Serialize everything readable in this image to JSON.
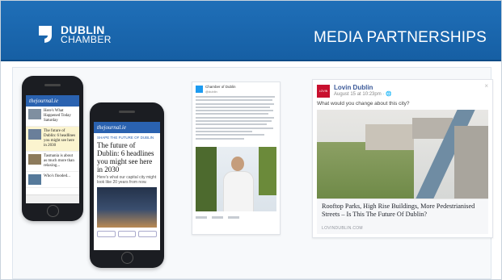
{
  "header": {
    "logo_line1": "DUBLIN",
    "logo_line2": "CHAMBER",
    "title": "MEDIA PARTNERSHIPS",
    "bg_color": "#1b66ad"
  },
  "phone_left": {
    "brand": "thejournal.ie",
    "items": [
      {
        "text": "Here's What Happened Today Saturday"
      },
      {
        "text": "The future of Dublin: 6 headlines you might see here in 2030"
      },
      {
        "text": "Tasmania is about as much more than relaxing..."
      },
      {
        "text": "Who's flooded..."
      }
    ]
  },
  "phone_right": {
    "brand": "thejournal.ie",
    "tag": "SHAPE THE FUTURE OF DUBLIN",
    "headline": "The future of Dublin: 6 headlines you might see here in 2030",
    "sub": "Here's what our capital city might look like 20 years from now."
  },
  "tweet": {
    "name": "Chamber of Dublin",
    "handle": "@dublin"
  },
  "facebook_post": {
    "page_name": "Lovin Dublin",
    "date": "August 15 at 10:23pm · 🌐",
    "status": "What would you change about this city?",
    "link_headline": "Rooftop Parks, High Rise Buildings, More Pedestrianised Streets – Is This The Future Of Dublin?",
    "link_source": "LOVINDUBLIN.COM",
    "logo_text": "LOVIN DUBLIN",
    "close": "×"
  }
}
